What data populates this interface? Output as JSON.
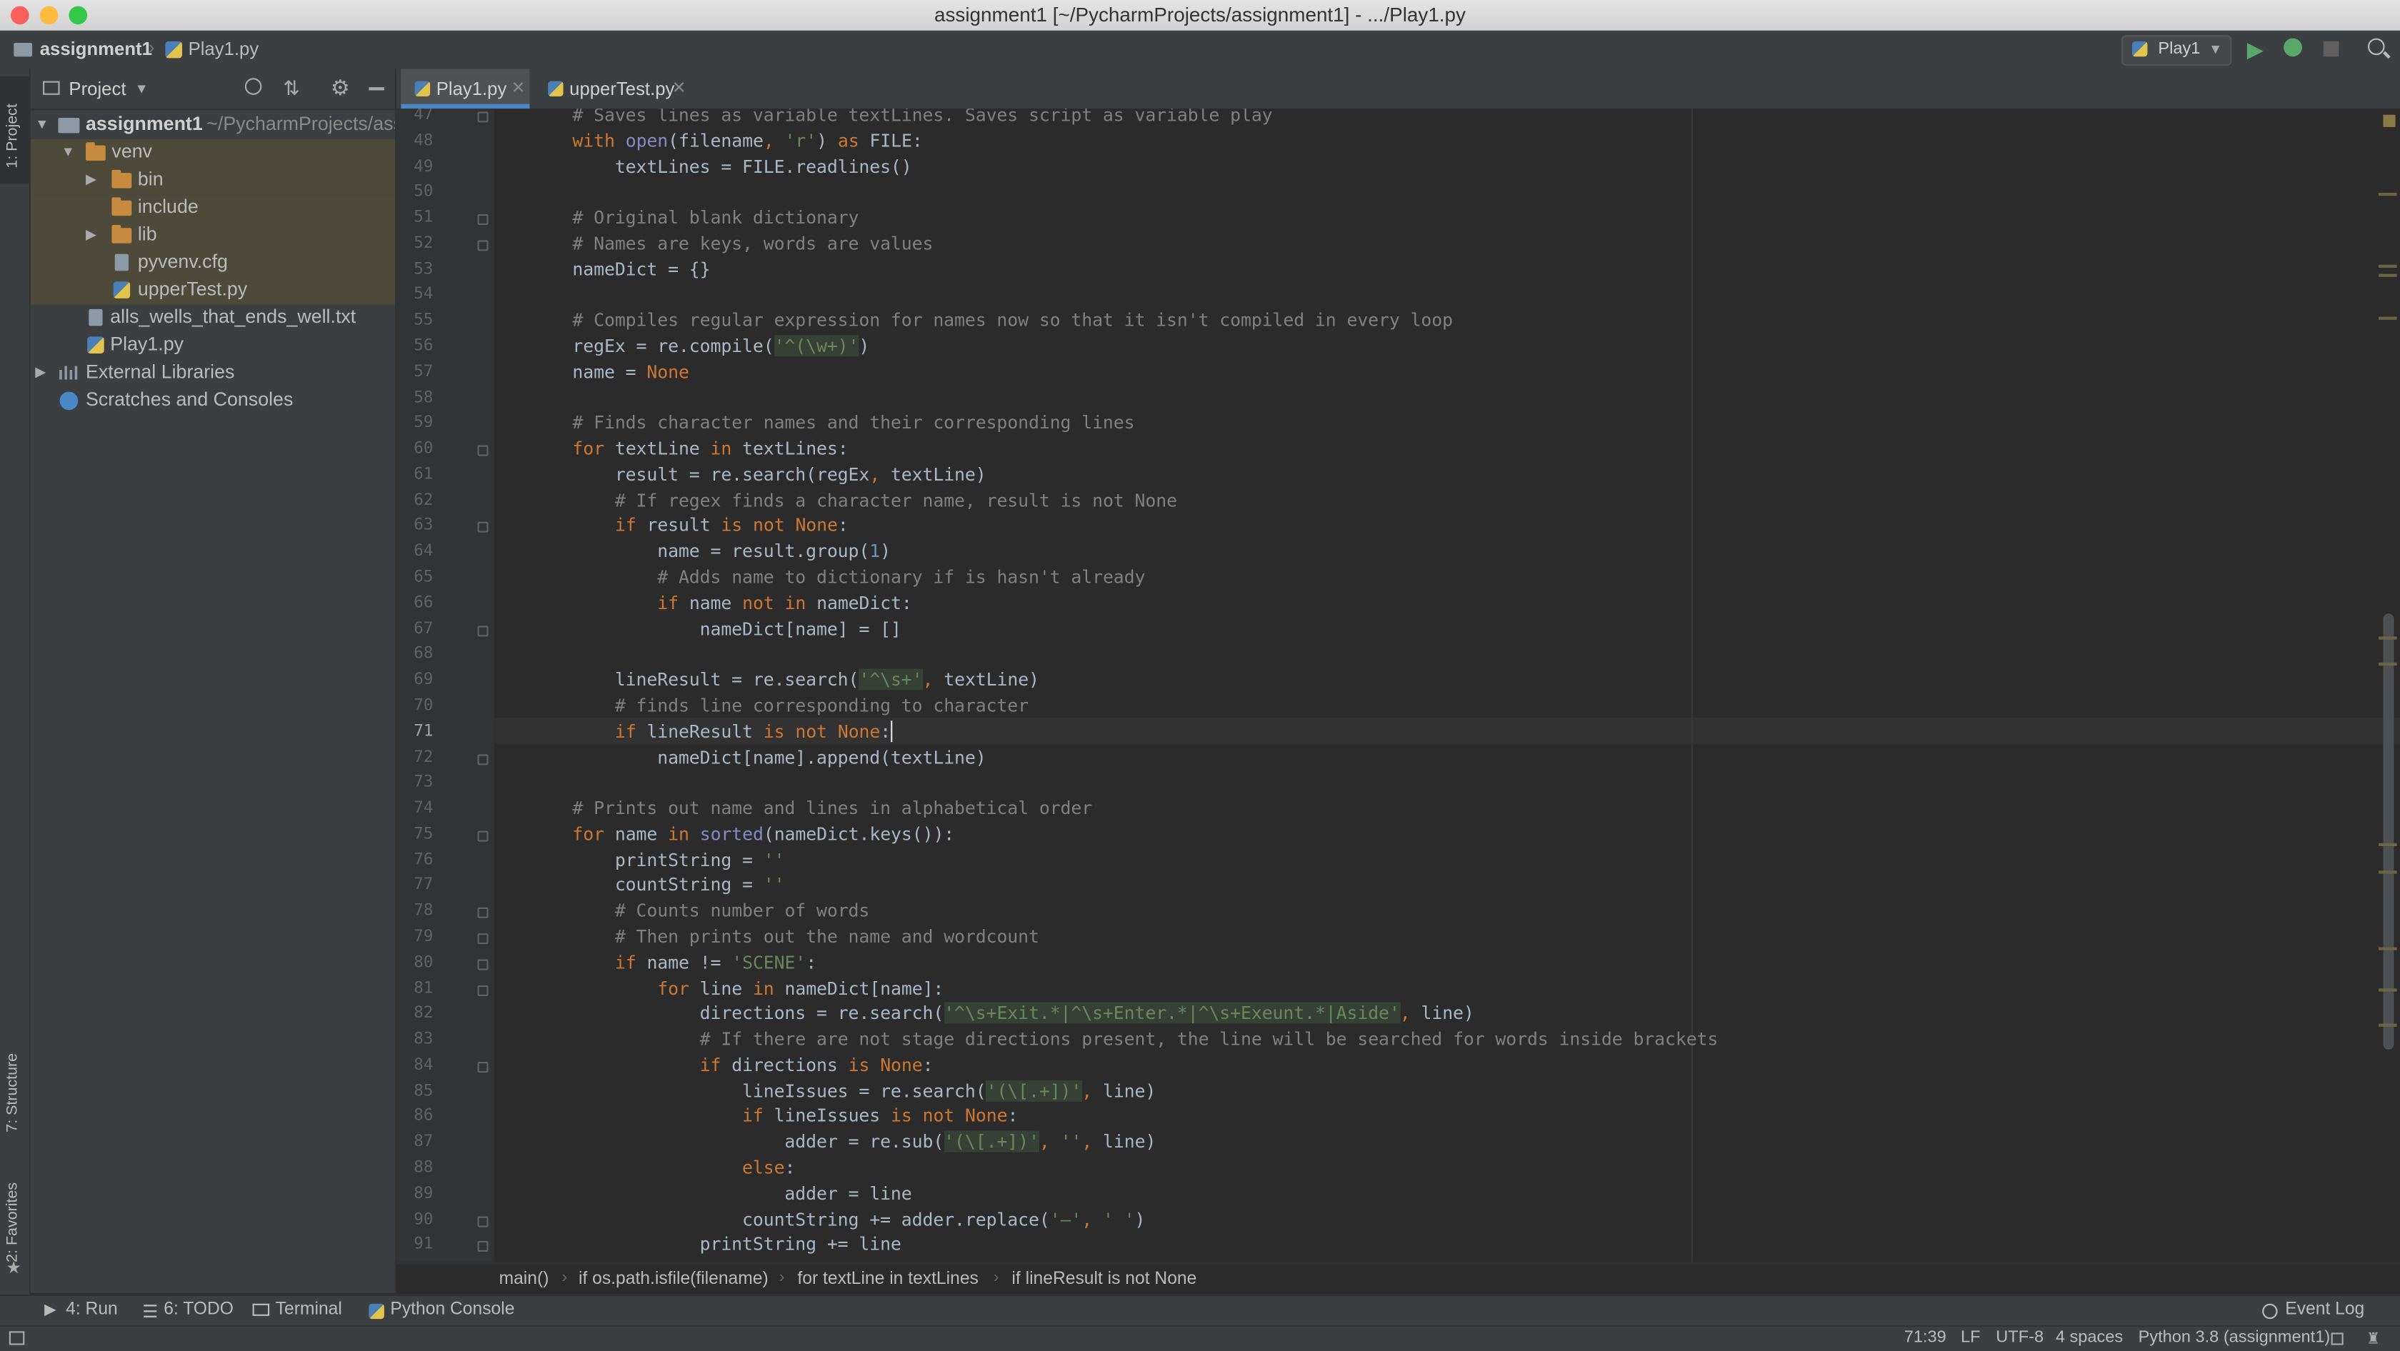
{
  "window": {
    "title": "assignment1 [~/PycharmProjects/assignment1] - .../Play1.py"
  },
  "navbar": {
    "project": "assignment1",
    "file": "Play1.py",
    "run_config": "Play1"
  },
  "left_strip": {
    "project_tab": "1: Project",
    "structure_tab": "7: Structure",
    "favorites_tab": "2: Favorites"
  },
  "project_panel": {
    "title": "Project",
    "tree": [
      {
        "label": "assignment1",
        "suffix": "~/PycharmProjects/ass",
        "type": "module",
        "expanded": true
      },
      {
        "label": "venv",
        "type": "folder",
        "expanded": true
      },
      {
        "label": "bin",
        "type": "folder",
        "expanded": false
      },
      {
        "label": "include",
        "type": "folder"
      },
      {
        "label": "lib",
        "type": "folder",
        "expanded": false
      },
      {
        "label": "pyvenv.cfg",
        "type": "file"
      },
      {
        "label": "upperTest.py",
        "type": "python"
      },
      {
        "label": "alls_wells_that_ends_well.txt",
        "type": "file"
      },
      {
        "label": "Play1.py",
        "type": "python"
      },
      {
        "label": "External Libraries",
        "type": "library",
        "expanded": false
      },
      {
        "label": "Scratches and Consoles",
        "type": "scratch"
      }
    ]
  },
  "tabs": [
    {
      "label": "Play1.py",
      "active": true
    },
    {
      "label": "upperTest.py",
      "active": false
    }
  ],
  "editor": {
    "current_line": 71,
    "lines": [
      {
        "n": "47",
        "text": "# Saves lines as variable textLines. Saves script as variable play"
      },
      {
        "n": "48",
        "text": "with open(filename, 'r') as FILE:"
      },
      {
        "n": "49",
        "text": "    textLines = FILE.readlines()"
      },
      {
        "n": "50",
        "text": ""
      },
      {
        "n": "51",
        "text": "# Original blank dictionary"
      },
      {
        "n": "52",
        "text": "# Names are keys, words are values"
      },
      {
        "n": "53",
        "text": "nameDict = {}"
      },
      {
        "n": "54",
        "text": ""
      },
      {
        "n": "55",
        "text": "# Compiles regular expression for names now so that it isn't compiled in every loop"
      },
      {
        "n": "56",
        "text": "regEx = re.compile('^(\\w+)')"
      },
      {
        "n": "57",
        "text": "name = None"
      },
      {
        "n": "58",
        "text": ""
      },
      {
        "n": "59",
        "text": "# Finds character names and their corresponding lines"
      },
      {
        "n": "60",
        "text": "for textLine in textLines:"
      },
      {
        "n": "61",
        "text": "    result = re.search(regEx, textLine)"
      },
      {
        "n": "62",
        "text": "    # If regex finds a character name, result is not None"
      },
      {
        "n": "63",
        "text": "    if result is not None:"
      },
      {
        "n": "64",
        "text": "        name = result.group(1)"
      },
      {
        "n": "65",
        "text": "        # Adds name to dictionary if is hasn't already"
      },
      {
        "n": "66",
        "text": "        if name not in nameDict:"
      },
      {
        "n": "67",
        "text": "            nameDict[name] = []"
      },
      {
        "n": "68",
        "text": ""
      },
      {
        "n": "69",
        "text": "    lineResult = re.search('^\\s+', textLine)"
      },
      {
        "n": "70",
        "text": "    # finds line corresponding to character"
      },
      {
        "n": "71",
        "text": "    if lineResult is not None:"
      },
      {
        "n": "72",
        "text": "        nameDict[name].append(textLine)"
      },
      {
        "n": "73",
        "text": ""
      },
      {
        "n": "74",
        "text": "# Prints out name and lines in alphabetical order"
      },
      {
        "n": "75",
        "text": "for name in sorted(nameDict.keys()):"
      },
      {
        "n": "76",
        "text": "    printString = ''"
      },
      {
        "n": "77",
        "text": "    countString = ''"
      },
      {
        "n": "78",
        "text": "    # Counts number of words"
      },
      {
        "n": "79",
        "text": "    # Then prints out the name and wordcount"
      },
      {
        "n": "80",
        "text": "    if name != 'SCENE':"
      },
      {
        "n": "81",
        "text": "        for line in nameDict[name]:"
      },
      {
        "n": "82",
        "text": "            directions = re.search('^\\s+Exit.*|^\\s+Enter.*|^\\s+Exeunt.*|Aside', line)"
      },
      {
        "n": "83",
        "text": "            # If there are not stage directions present, the line will be searched for words inside brackets"
      },
      {
        "n": "84",
        "text": "            if directions is None:"
      },
      {
        "n": "85",
        "text": "                lineIssues = re.search('(\\[.+])', line)"
      },
      {
        "n": "86",
        "text": "                if lineIssues is not None:"
      },
      {
        "n": "87",
        "text": "                    adder = re.sub('(\\[.+])', '', line)"
      },
      {
        "n": "88",
        "text": "                else:"
      },
      {
        "n": "89",
        "text": "                    adder = line"
      },
      {
        "n": "90",
        "text": "                countString += adder.replace('—', ' ')"
      },
      {
        "n": "91",
        "text": "            printString += line"
      }
    ]
  },
  "breadcrumbs": [
    "main()",
    "if os.path.isfile(filename)",
    "for textLine in textLines",
    "if lineResult is not None"
  ],
  "bottom_tools": {
    "run": "4: Run",
    "todo": "6: TODO",
    "terminal": "Terminal",
    "python_console": "Python Console",
    "event_log": "Event Log"
  },
  "status": {
    "position": "71:39",
    "line_sep": "LF",
    "encoding": "UTF-8",
    "indent": "4 spaces",
    "interpreter": "Python 3.8 (assignment1)"
  },
  "colors": {
    "keyword": "#cc7832",
    "comment": "#808080",
    "string": "#6a8759",
    "number": "#6897bb",
    "builtin": "#8888c6",
    "text": "#a9b7c6",
    "background": "#2b2b2b"
  }
}
